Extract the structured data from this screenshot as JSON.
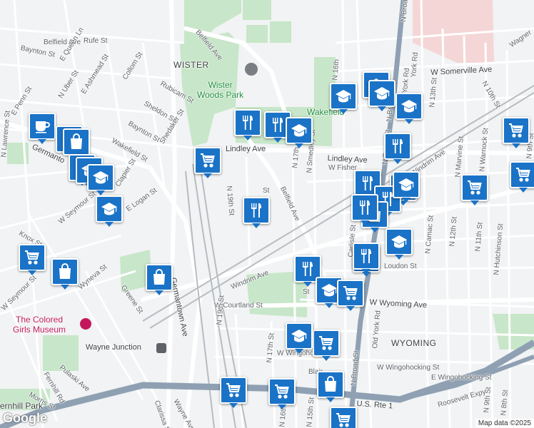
{
  "map": {
    "credit": "Map data ©2025",
    "logo": "Google",
    "areas": [
      {
        "id": "wister",
        "text": "WISTER"
      },
      {
        "id": "wakefield",
        "text": "Wakefield"
      },
      {
        "id": "wister-woods",
        "text": "Wister\nWoods Park"
      },
      {
        "id": "wyoming",
        "text": "WYOMING"
      },
      {
        "id": "fernhill",
        "text": "ernhill Park"
      }
    ],
    "pois": [
      {
        "id": "colored-girls",
        "text": "The Colored\nGirls Museum"
      },
      {
        "id": "wayne-junction",
        "text": "Wayne Junction"
      }
    ],
    "streets": [
      {
        "id": "s1",
        "text": "Belfield Ave"
      },
      {
        "id": "s2",
        "text": "Belfield Ave"
      },
      {
        "id": "s3",
        "text": "Belfield Ave"
      },
      {
        "id": "s4",
        "text": "Rufe St"
      },
      {
        "id": "s5",
        "text": "Baynton St"
      },
      {
        "id": "s6",
        "text": "E Queen Ln"
      },
      {
        "id": "s7",
        "text": "E Ashmead St"
      },
      {
        "id": "s8",
        "text": "Collom St"
      },
      {
        "id": "s9",
        "text": "Rubicam St"
      },
      {
        "id": "s10",
        "text": "Sheldon St"
      },
      {
        "id": "s11",
        "text": "Baynton St"
      },
      {
        "id": "s12",
        "text": "Shedaker St"
      },
      {
        "id": "s13",
        "text": "Wakefield St"
      },
      {
        "id": "s14",
        "text": "E Penn St"
      },
      {
        "id": "s15",
        "text": "Germanto"
      },
      {
        "id": "s16",
        "text": "Clapier St"
      },
      {
        "id": "s17",
        "text": "E Logan St"
      },
      {
        "id": "s18",
        "text": "W Seymour St"
      },
      {
        "id": "s19",
        "text": "Knox St"
      },
      {
        "id": "s20",
        "text": "Wyneva St"
      },
      {
        "id": "s21",
        "text": "W Seymour St"
      },
      {
        "id": "s22",
        "text": "Greene St"
      },
      {
        "id": "s23",
        "text": "Germantown Ave"
      },
      {
        "id": "s24",
        "text": "Pulaski Ave"
      },
      {
        "id": "s25",
        "text": "Fernhill Rd"
      },
      {
        "id": "s26",
        "text": "Morris St"
      },
      {
        "id": "s27",
        "text": "Windrim Ave"
      },
      {
        "id": "s28",
        "text": "W Courtland St"
      },
      {
        "id": "s29",
        "text": "N 19th St"
      },
      {
        "id": "s30",
        "text": "N 19th St"
      },
      {
        "id": "s31",
        "text": "N 17th St"
      },
      {
        "id": "s32",
        "text": "N Smedley St"
      },
      {
        "id": "s33",
        "text": "Lindley Ave"
      },
      {
        "id": "s34",
        "text": "W Fisher"
      },
      {
        "id": "s35",
        "text": "W Somerville Ave"
      },
      {
        "id": "s36",
        "text": "N Broad St"
      },
      {
        "id": "s37",
        "text": "N Broad St"
      },
      {
        "id": "s38",
        "text": "N Broad St"
      },
      {
        "id": "s39",
        "text": "N Broad"
      },
      {
        "id": "s40",
        "text": "N 16th"
      },
      {
        "id": "s41",
        "text": "York Rd"
      },
      {
        "id": "s42",
        "text": "N 13th St"
      },
      {
        "id": "s43",
        "text": "N 10th St"
      },
      {
        "id": "s44",
        "text": "Wagner"
      },
      {
        "id": "s45",
        "text": "N 12th St"
      },
      {
        "id": "s46",
        "text": "N Camac St"
      },
      {
        "id": "s47",
        "text": "N Marvine St"
      },
      {
        "id": "s48",
        "text": "N Warnock St"
      },
      {
        "id": "s49",
        "text": "N 11th St"
      },
      {
        "id": "s50",
        "text": "N Hutchinson St"
      },
      {
        "id": "s51",
        "text": "N 9th St"
      },
      {
        "id": "s52",
        "text": "Old York Rd"
      },
      {
        "id": "s53",
        "text": "W Wyoming Ave"
      },
      {
        "id": "s54",
        "text": "W Wingohocking St"
      },
      {
        "id": "s55",
        "text": "W Wingohocking St"
      },
      {
        "id": "s56",
        "text": "E Wingohocking St"
      },
      {
        "id": "s57",
        "text": "Roosevelt Expy"
      },
      {
        "id": "s58",
        "text": "U.S. Rte 1"
      },
      {
        "id": "s59",
        "text": "N 9th St"
      },
      {
        "id": "s60",
        "text": "N 8th St"
      },
      {
        "id": "s61",
        "text": "Wayne Ave"
      },
      {
        "id": "s62",
        "text": "Clarissa St"
      },
      {
        "id": "s63",
        "text": "N 16th St"
      },
      {
        "id": "s64",
        "text": "N 15th St"
      },
      {
        "id": "s65",
        "text": "N 17th St"
      },
      {
        "id": "s66",
        "text": "Carlisle St"
      },
      {
        "id": "s67",
        "text": "Loudon St"
      },
      {
        "id": "s68",
        "text": "Windrim Ave"
      },
      {
        "id": "s69",
        "text": "Lindley Ave"
      },
      {
        "id": "s70",
        "text": "Blair"
      },
      {
        "id": "s71",
        "text": "St"
      },
      {
        "id": "s72",
        "text": "St"
      },
      {
        "id": "s73",
        "text": "N Uber St"
      },
      {
        "id": "s74",
        "text": "N Lawrence St"
      },
      {
        "id": "s75",
        "text": "York Rd"
      }
    ],
    "markers": [
      {
        "id": "m1",
        "icon": "cafe-icon"
      },
      {
        "id": "m2",
        "icon": "shopping-bag-icon"
      },
      {
        "id": "m3",
        "icon": "shopping-bag-icon"
      },
      {
        "id": "m4",
        "icon": "shopping-bag-icon"
      },
      {
        "id": "m5",
        "icon": "school-icon"
      },
      {
        "id": "m6",
        "icon": "school-icon"
      },
      {
        "id": "m7",
        "icon": "shopping-cart-icon"
      },
      {
        "id": "m8",
        "icon": "restaurant-icon"
      },
      {
        "id": "m9",
        "icon": "restaurant-icon"
      },
      {
        "id": "m10",
        "icon": "school-icon"
      },
      {
        "id": "m11",
        "icon": "restaurant-icon"
      },
      {
        "id": "m12",
        "icon": "school-icon"
      },
      {
        "id": "m13",
        "icon": "school-icon"
      },
      {
        "id": "m14",
        "icon": "school-icon"
      },
      {
        "id": "m15",
        "icon": "school-icon"
      },
      {
        "id": "m16",
        "icon": "restaurant-icon"
      },
      {
        "id": "m17",
        "icon": "restaurant-icon"
      },
      {
        "id": "m18",
        "icon": "school-icon"
      },
      {
        "id": "m19",
        "icon": "restaurant-icon"
      },
      {
        "id": "m20",
        "icon": "restaurant-icon"
      },
      {
        "id": "m21",
        "icon": "shopping-bag-icon"
      },
      {
        "id": "m22",
        "icon": "school-icon"
      },
      {
        "id": "m23",
        "icon": "restaurant-icon"
      },
      {
        "id": "m24",
        "icon": "restaurant-icon"
      },
      {
        "id": "m25",
        "icon": "school-icon"
      },
      {
        "id": "m26",
        "icon": "restaurant-icon"
      },
      {
        "id": "m27",
        "icon": "shopping-cart-icon"
      },
      {
        "id": "m28",
        "icon": "shopping-cart-icon"
      },
      {
        "id": "m29",
        "icon": "shopping-cart-icon"
      },
      {
        "id": "m30",
        "icon": "shopping-cart-icon"
      },
      {
        "id": "m31",
        "icon": "shopping-bag-icon"
      },
      {
        "id": "m32",
        "icon": "shopping-bag-icon"
      },
      {
        "id": "m33",
        "icon": "school-icon"
      },
      {
        "id": "m34",
        "icon": "shopping-cart-icon"
      },
      {
        "id": "m35",
        "icon": "shopping-cart-icon"
      },
      {
        "id": "m36",
        "icon": "shopping-cart-icon"
      },
      {
        "id": "m37",
        "icon": "shopping-bag-icon"
      },
      {
        "id": "m38",
        "icon": "shopping-cart-icon"
      }
    ],
    "colors": {
      "marker": "#1a73c7",
      "park": "#c8e6c9",
      "land": "#f1f3f4",
      "road": "#ffffff",
      "highway": "#9aa5b1",
      "rail": "#b0b5ba",
      "poi": "#c2185b",
      "hospital": "#f5d6d6"
    }
  }
}
